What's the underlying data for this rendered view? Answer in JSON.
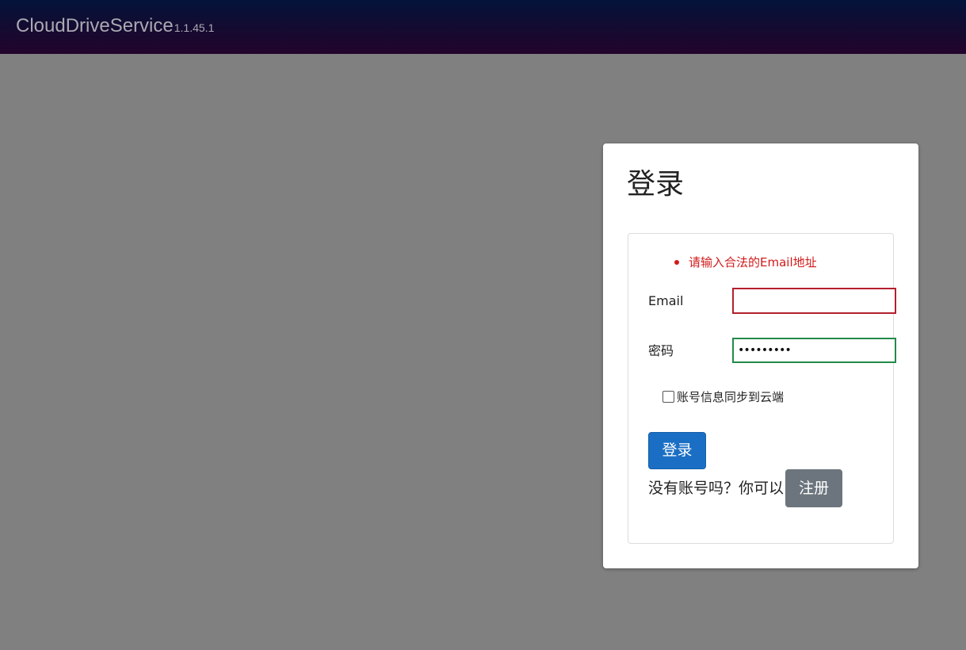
{
  "header": {
    "brand": "CloudDriveService",
    "version": "1.1.45.1"
  },
  "login": {
    "title": "登录",
    "errors": [
      "请输入合法的Email地址"
    ],
    "email_label": "Email",
    "email_value": "",
    "password_label": "密码",
    "password_value": "•••••••••",
    "sync_label": "账号信息同步到云端",
    "sync_checked": false,
    "submit_label": "登录",
    "no_account_text": "没有账号吗？你可以",
    "register_label": "注册"
  },
  "colors": {
    "background": "#808080",
    "header_top": "#03133a",
    "header_bottom": "#22042b",
    "primary_button": "#1a6fc5",
    "secondary_button": "#6c757d",
    "error": "#d11a1a",
    "invalid_border": "#b3202e",
    "valid_border": "#238a4a"
  }
}
